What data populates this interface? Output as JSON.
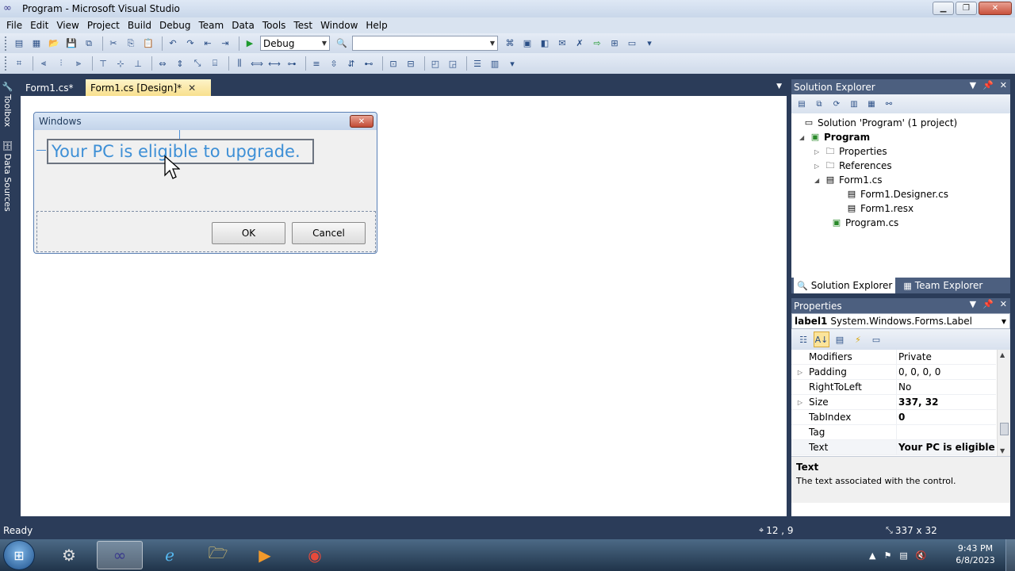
{
  "window": {
    "title": "Program - Microsoft Visual Studio"
  },
  "menu": [
    "File",
    "Edit",
    "View",
    "Project",
    "Build",
    "Debug",
    "Team",
    "Data",
    "Tools",
    "Test",
    "Window",
    "Help"
  ],
  "toolbar": {
    "config_value": "Debug",
    "platform_value": ""
  },
  "left_rail": {
    "toolbox": "Toolbox",
    "data_sources": "Data Sources"
  },
  "tabs": [
    {
      "label": "Form1.cs*"
    },
    {
      "label": "Form1.cs [Design]*"
    }
  ],
  "form": {
    "title": "Windows",
    "label_text": "Your PC is eligible to upgrade.",
    "ok_label": "OK",
    "cancel_label": "Cancel"
  },
  "solution_explorer": {
    "header": "Solution Explorer",
    "tree": {
      "solution": "Solution 'Program' (1 project)",
      "project": "Program",
      "properties": "Properties",
      "references": "References",
      "form1": "Form1.cs",
      "designer": "Form1.Designer.cs",
      "resx": "Form1.resx",
      "program": "Program.cs"
    },
    "tab_solution": "Solution Explorer",
    "tab_team": "Team Explorer"
  },
  "properties": {
    "header": "Properties",
    "object_name": "label1",
    "object_type": "System.Windows.Forms.Label",
    "rows": [
      {
        "name": "Modifiers",
        "value": "Private"
      },
      {
        "name": "Padding",
        "value": "0, 0, 0, 0"
      },
      {
        "name": "RightToLeft",
        "value": "No"
      },
      {
        "name": "Size",
        "value": "337, 32"
      },
      {
        "name": "TabIndex",
        "value": "0"
      },
      {
        "name": "Tag",
        "value": ""
      },
      {
        "name": "Text",
        "value": "Your PC is eligible to u"
      }
    ],
    "desc_title": "Text",
    "desc_text": "The text associated with the control."
  },
  "status": {
    "ready": "Ready",
    "position": "12 , 9",
    "size": "337 x 32"
  },
  "clock": {
    "time": "9:43 PM",
    "date": "6/8/2023"
  },
  "colors": {
    "ide_background": "#2b3c59",
    "label_text": "#3d8fd6",
    "active_tab": "#f8e08e"
  }
}
